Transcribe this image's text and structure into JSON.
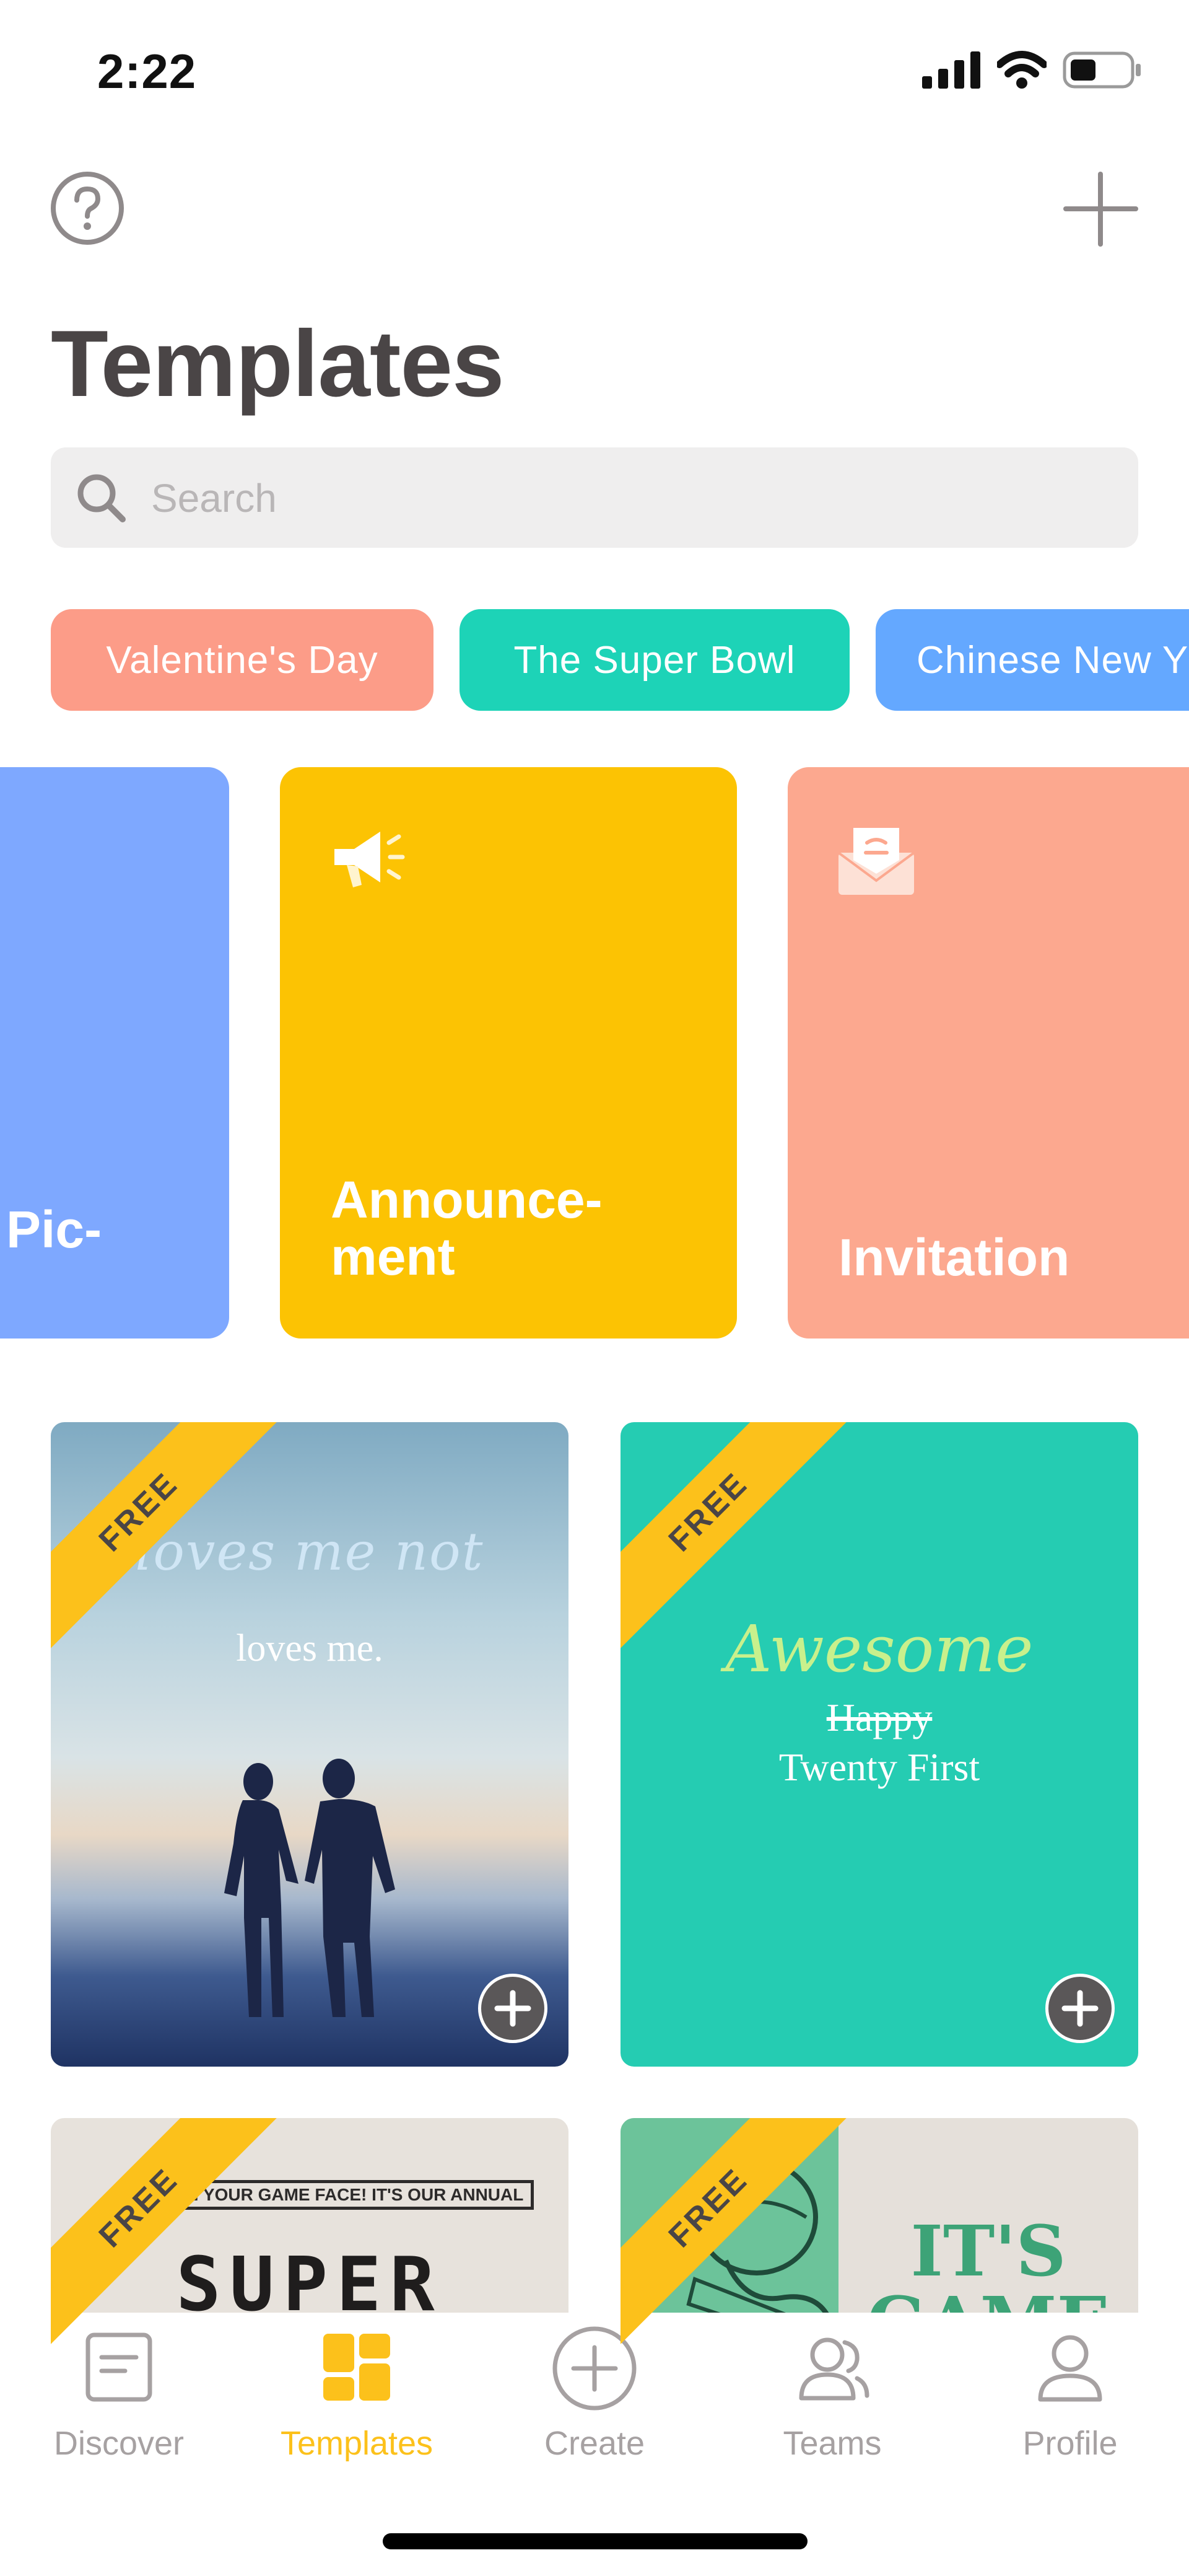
{
  "status_bar": {
    "time": "2:22"
  },
  "header": {
    "title": "Templates"
  },
  "search": {
    "placeholder": "Search",
    "value": ""
  },
  "chips": [
    {
      "label": "Valentine's Day",
      "color": "#fc9c88"
    },
    {
      "label": "The Super Bowl",
      "color": "#1dd3b7"
    },
    {
      "label": "Chinese New Y",
      "color": "#64a8ff"
    }
  ],
  "categories": [
    {
      "label": "Pic-",
      "color": "#7ea8ff"
    },
    {
      "label": "Announce-\nment",
      "color": "#fcc303",
      "icon": "megaphone-icon"
    },
    {
      "label": "Invitation",
      "color": "#fca88f",
      "icon": "envelope-icon"
    }
  ],
  "templates": [
    {
      "badge": "FREE",
      "text_script": "loves me not",
      "text_main": "loves me."
    },
    {
      "badge": "FREE",
      "text_script": "Awesome",
      "text_strike": "Happy",
      "text_main": "Twenty First"
    },
    {
      "badge": "FREE",
      "text_banner": "ON YOUR GAME FACE! IT'S OUR ANNUAL",
      "text_main": "SUPER"
    },
    {
      "badge": "FREE",
      "text_main": "IT'S",
      "text_sub": "GAME"
    }
  ],
  "tabbar": {
    "items": [
      {
        "label": "Discover",
        "icon": "discover-icon",
        "active": false
      },
      {
        "label": "Templates",
        "icon": "templates-icon",
        "active": true
      },
      {
        "label": "Create",
        "icon": "create-icon",
        "active": false
      },
      {
        "label": "Teams",
        "icon": "teams-icon",
        "active": false
      },
      {
        "label": "Profile",
        "icon": "profile-icon",
        "active": false
      }
    ]
  },
  "colors": {
    "accent": "#fcc11b",
    "text": "#4a4546",
    "inactive": "#a6a1a2"
  }
}
